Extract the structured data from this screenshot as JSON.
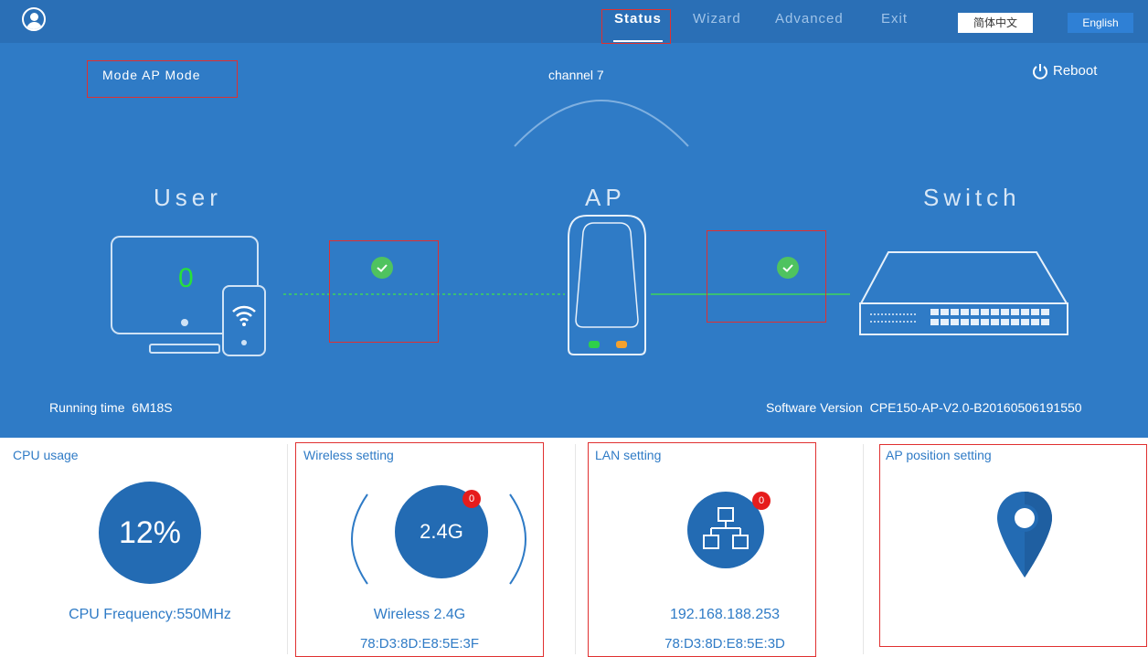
{
  "nav": {
    "items": [
      "Status",
      "Wizard",
      "Advanced",
      "Exit"
    ],
    "active": "Status",
    "languages": [
      "简体中文",
      "English"
    ]
  },
  "status": {
    "mode_label": "Mode",
    "mode_value": "AP Mode",
    "channel": "channel 7",
    "reboot_label": "Reboot",
    "user_label": "User",
    "ap_label": "AP",
    "switch_label": "Switch",
    "user_count": "0",
    "running_time_label": "Running time",
    "running_time": "6M18S",
    "software_version_label": "Software Version",
    "software_version": "CPE150-AP-V2.0-B20160506191550"
  },
  "cards": {
    "cpu": {
      "title": "CPU usage",
      "usage": "12%",
      "frequency": "CPU Frequency:550MHz"
    },
    "wireless": {
      "title": "Wireless setting",
      "band": "2.4G",
      "badge": "0",
      "name": "Wireless 2.4G",
      "mac": "78:D3:8D:E8:5E:3F"
    },
    "lan": {
      "title": "LAN setting",
      "badge": "0",
      "ip": "192.168.188.253",
      "mac": "78:D3:8D:E8:5E:3D"
    },
    "ap_position": {
      "title": "AP position setting"
    }
  },
  "colors": {
    "banner": "#2f7bc6",
    "navbar": "#2a6fb6",
    "circle": "#236bb3",
    "ok_green": "#4fc35f",
    "badge_red": "#e61c1c",
    "highlight_red": "#e03030"
  },
  "icons": [
    "user-avatar-icon",
    "power-icon",
    "monitor-icon",
    "phone-wifi-icon",
    "router-device-icon",
    "network-switch-icon",
    "check-icon",
    "lan-network-icon",
    "location-pin-icon"
  ]
}
